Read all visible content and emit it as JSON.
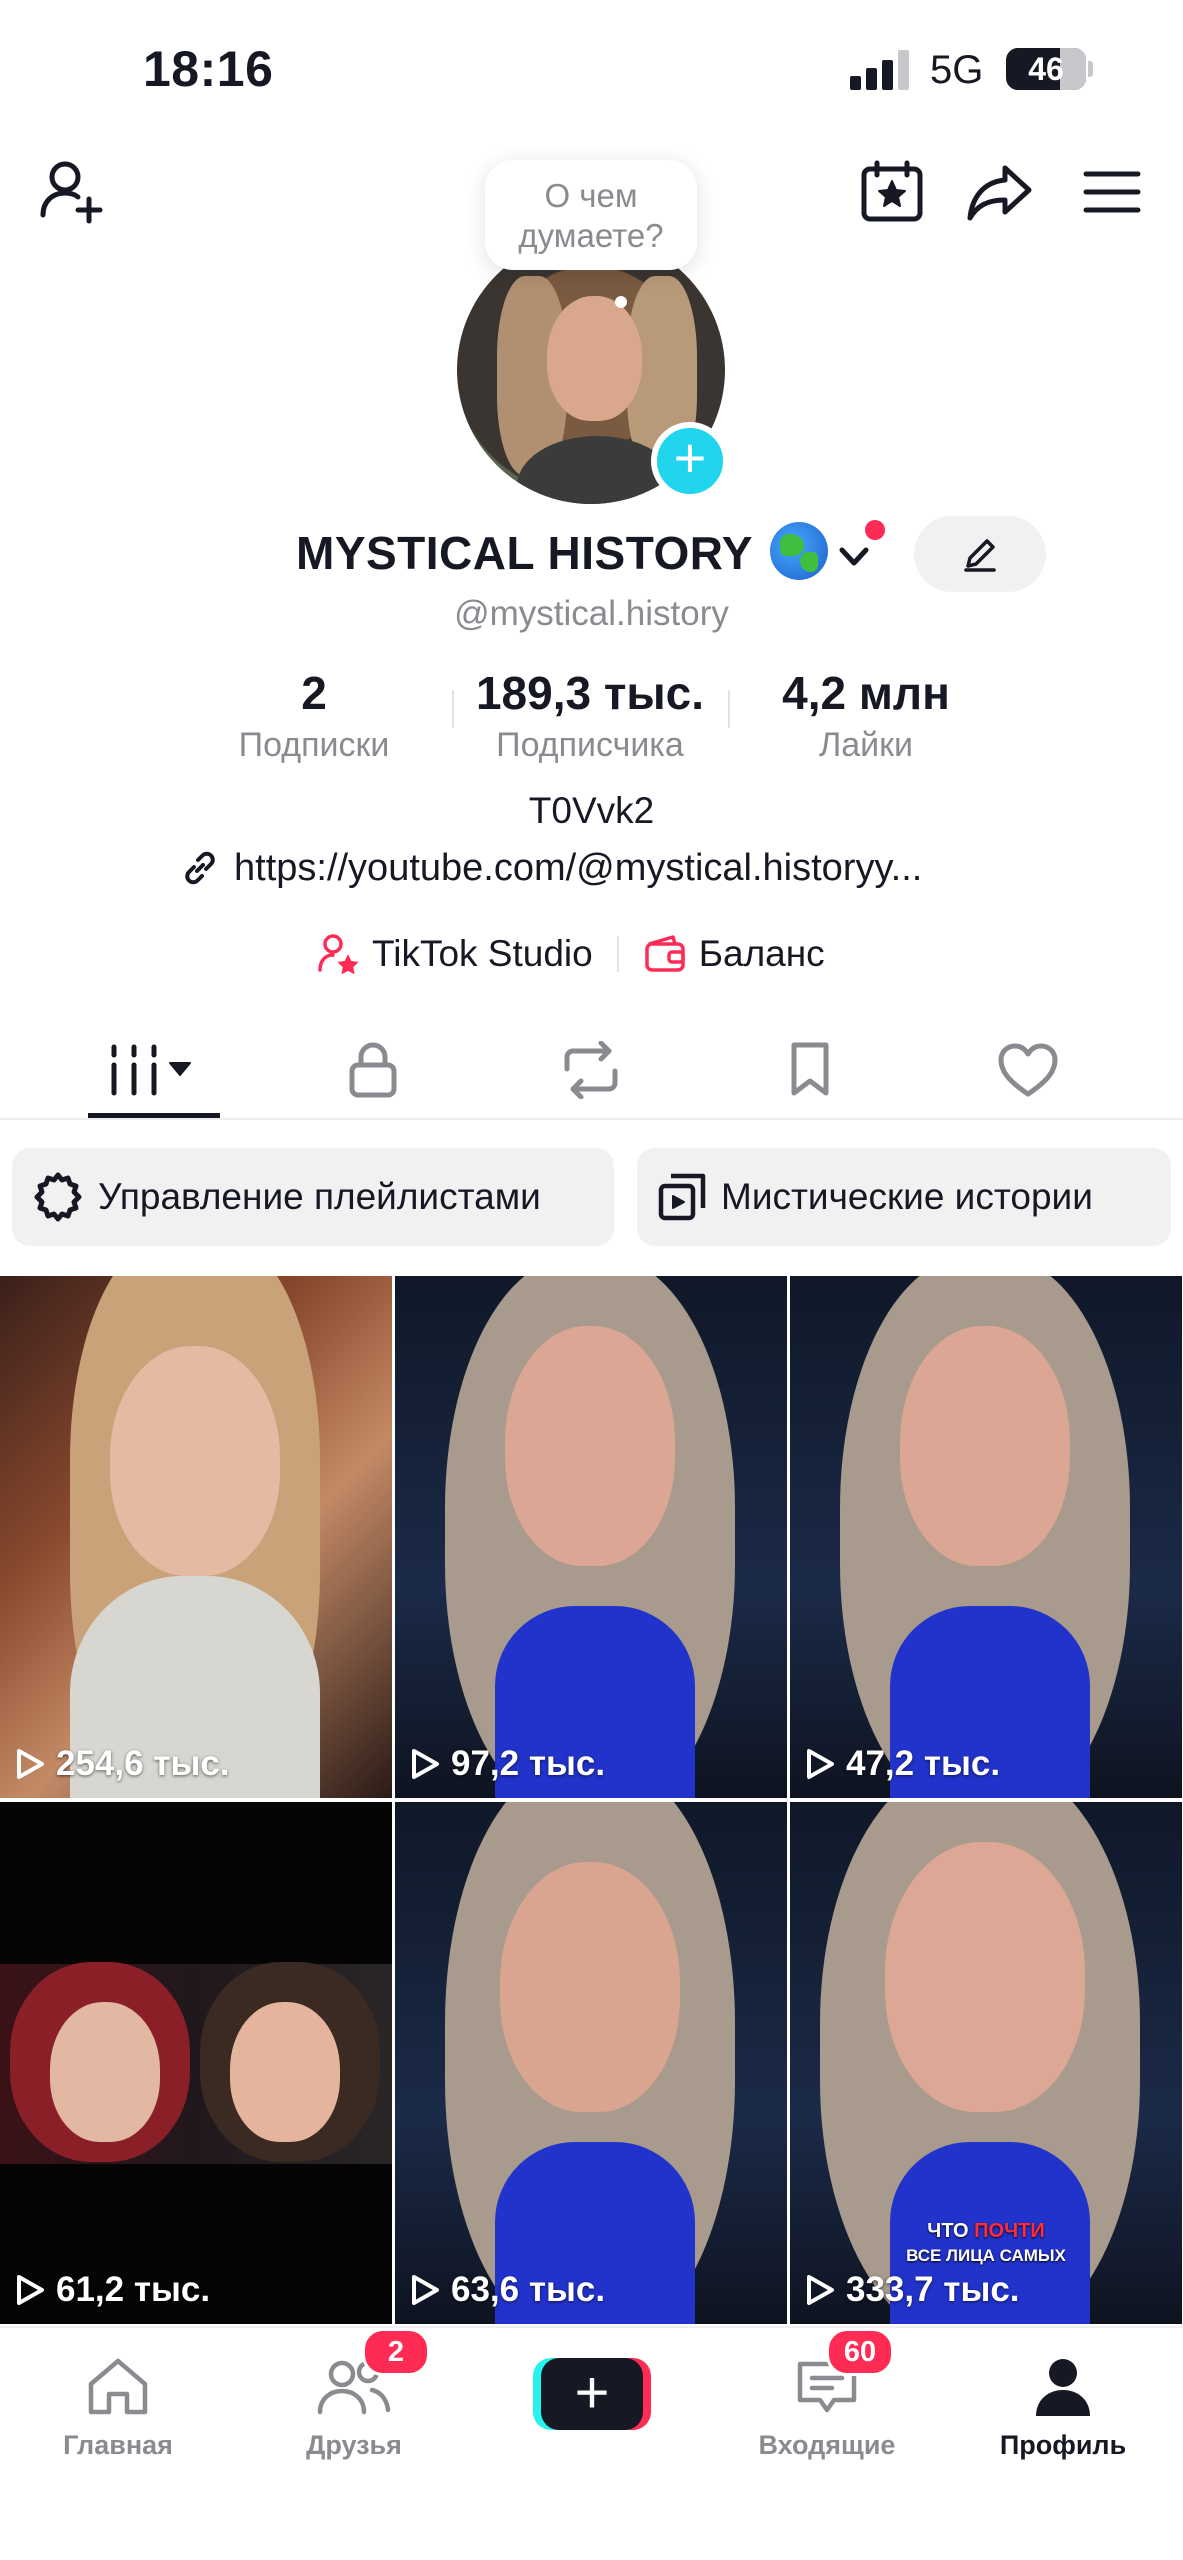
{
  "status_bar": {
    "time": "18:16",
    "network": "5G",
    "battery": "46"
  },
  "avatar_bubble": {
    "line1": "О чем",
    "line2": "думаете?"
  },
  "profile": {
    "display_name": "MYSTICAL HISTORY",
    "handle": "@mystical.history",
    "bio": "T0Vvk2",
    "link": "https://youtube.com/@mystical.historyy...",
    "studio_label": "TikTok Studio",
    "balance_label": "Баланс"
  },
  "stats": [
    {
      "value": "2",
      "label": "Подписки"
    },
    {
      "value": "189,3 тыс.",
      "label": "Подписчика"
    },
    {
      "value": "4,2 млн",
      "label": "Лайки"
    }
  ],
  "chips": {
    "manage": "Управление плейлистами",
    "playlist": "Мистические истории"
  },
  "videos": [
    {
      "views": "254,6 тыс."
    },
    {
      "views": "97,2 тыс."
    },
    {
      "views": "47,2 тыс."
    },
    {
      "views": "61,2 тыс."
    },
    {
      "views": "63,6 тыс."
    },
    {
      "views": "333,7 тыс.",
      "caption_line1_a": "ЧТО ",
      "caption_line1_b": "ПОЧТИ",
      "caption_line2": "ВСЕ ЛИЦА САМЫХ"
    }
  ],
  "bottom_nav": {
    "home": "Главная",
    "friends": "Друзья",
    "friends_badge": "2",
    "inbox": "Входящие",
    "inbox_badge": "60",
    "profile": "Профиль"
  },
  "colors": {
    "accent": "#fe2c55",
    "cyan": "#25f4ee",
    "plus_blue": "#20d5ec",
    "text": "#161823",
    "muted": "#8a8b91"
  }
}
